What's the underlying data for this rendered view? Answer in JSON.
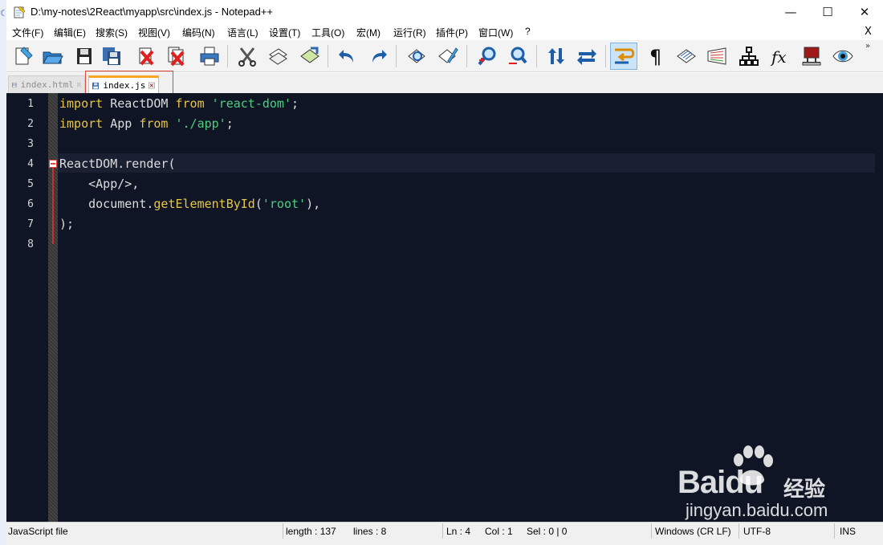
{
  "window": {
    "title": "D:\\my-notes\\2React\\myapp\\src\\index.js - Notepad++",
    "minimize_glyph": "—",
    "maximize_glyph": "☐",
    "close_glyph": "✕"
  },
  "menu": {
    "items": [
      "文件(F)",
      "编辑(E)",
      "搜索(S)",
      "视图(V)",
      "编码(N)",
      "语言(L)",
      "设置(T)",
      "工具(O)",
      "宏(M)",
      "运行(R)",
      "插件(P)",
      "窗口(W)",
      "?"
    ],
    "close_glyph": "X"
  },
  "toolbar": {
    "buttons": [
      "new-file-icon",
      "open-file-icon",
      "save-icon",
      "save-all-icon",
      "close-icon",
      "close-all-icon",
      "print-icon",
      "cut-icon",
      "copy-icon",
      "paste-icon",
      "undo-icon",
      "redo-icon",
      "find-icon",
      "replace-icon",
      "zoom-in-icon",
      "zoom-out-icon",
      "sync-vertical-icon",
      "sync-horizontal-icon",
      "word-wrap-icon",
      "show-all-chars-icon",
      "indent-guide-icon",
      "document-map-icon",
      "function-list-icon",
      "function-icon",
      "folder-as-workspace-icon",
      "monitoring-icon"
    ],
    "more_glyph": "»"
  },
  "tabs": [
    {
      "label": "index.html",
      "active": false
    },
    {
      "label": "index.js",
      "active": true
    }
  ],
  "editor": {
    "lines": [
      {
        "no": "1",
        "tokens": [
          {
            "t": "import",
            "c": "kw"
          },
          {
            "t": " ReactDOM ",
            "c": ""
          },
          {
            "t": "from",
            "c": "kw"
          },
          {
            "t": " ",
            "c": ""
          },
          {
            "t": "'react-dom'",
            "c": "str"
          },
          {
            "t": ";",
            "c": ""
          }
        ]
      },
      {
        "no": "2",
        "tokens": [
          {
            "t": "import",
            "c": "kw"
          },
          {
            "t": " App ",
            "c": ""
          },
          {
            "t": "from",
            "c": "kw"
          },
          {
            "t": " ",
            "c": ""
          },
          {
            "t": "'./app'",
            "c": "str"
          },
          {
            "t": ";",
            "c": ""
          }
        ]
      },
      {
        "no": "3",
        "tokens": []
      },
      {
        "no": "4",
        "tokens": [
          {
            "t": "ReactDOM.render(",
            "c": ""
          }
        ]
      },
      {
        "no": "5",
        "tokens": [
          {
            "t": "    <App/>,",
            "c": ""
          }
        ]
      },
      {
        "no": "6",
        "tokens": [
          {
            "t": "    document.",
            "c": ""
          },
          {
            "t": "getElementById",
            "c": "fn"
          },
          {
            "t": "(",
            "c": ""
          },
          {
            "t": "'root'",
            "c": "str"
          },
          {
            "t": "),",
            "c": ""
          }
        ]
      },
      {
        "no": "7",
        "tokens": [
          {
            "t": ");",
            "c": ""
          }
        ]
      },
      {
        "no": "8",
        "tokens": []
      }
    ],
    "colors": {
      "background": "#0f1525",
      "keyword": "#e8c547",
      "string": "#4ccf80",
      "text": "#dcdcdc"
    }
  },
  "status": {
    "language": "JavaScript file",
    "length": "length : 137",
    "lines": "lines : 8",
    "ln": "Ln : 4",
    "col": "Col : 1",
    "sel": "Sel : 0 | 0",
    "eol": "Windows (CR LF)",
    "encoding": "UTF-8",
    "mode": "INS"
  },
  "watermark": {
    "brand": "Bai",
    "brand_du": "du",
    "cn": "经验",
    "url": "jingyan.baidu.com"
  }
}
